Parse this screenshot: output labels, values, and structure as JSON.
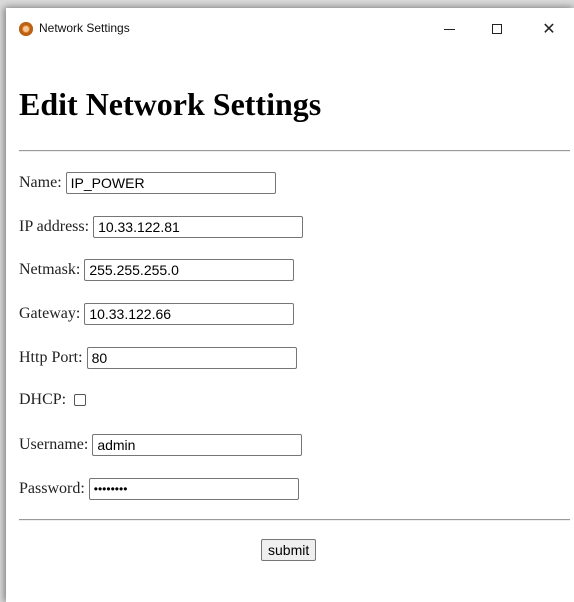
{
  "window": {
    "title": "Network Settings",
    "controls": {
      "minimize": "—",
      "maximize": "",
      "close": "✕"
    }
  },
  "page": {
    "heading": "Edit Network Settings"
  },
  "form": {
    "name": {
      "label": "Name:",
      "value": "IP_POWER"
    },
    "ip_address": {
      "label": "IP address:",
      "value": "10.33.122.81"
    },
    "netmask": {
      "label": "Netmask:",
      "value": "255.255.255.0"
    },
    "gateway": {
      "label": "Gateway:",
      "value": "10.33.122.66"
    },
    "http_port": {
      "label": "Http Port:",
      "value": "80"
    },
    "dhcp": {
      "label": "DHCP:",
      "checked": false
    },
    "username": {
      "label": "Username:",
      "value": "admin"
    },
    "password": {
      "label": "Password:",
      "value": "••••••••"
    },
    "submit_label": "submit"
  }
}
